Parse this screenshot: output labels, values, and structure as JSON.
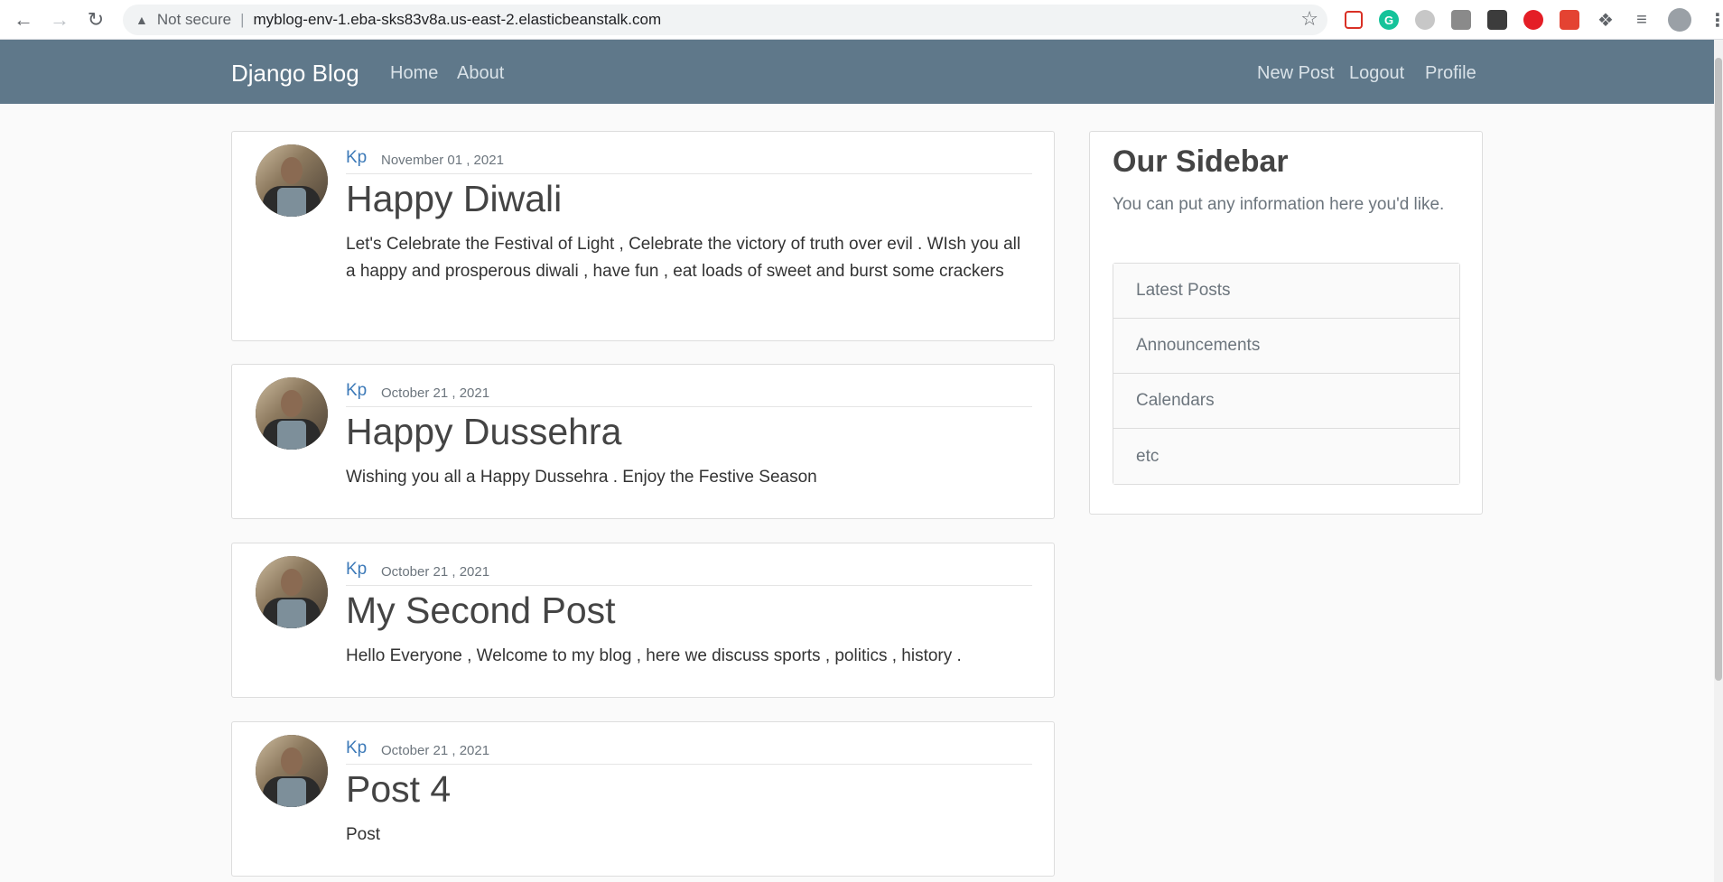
{
  "browser": {
    "security_label": "Not secure",
    "url": "myblog-env-1.eba-sks83v8a.us-east-2.elasticbeanstalk.com"
  },
  "navbar": {
    "brand": "Django Blog",
    "left_links": [
      "Home",
      "About"
    ],
    "right_links": [
      "New Post",
      "Logout",
      "Profile"
    ]
  },
  "posts": [
    {
      "author": "Kp",
      "date": "November 01 , 2021",
      "title": "Happy Diwali",
      "content": "Let's Celebrate the Festival of Light , Celebrate the victory of truth over evil . WIsh you all a happy and prosperous diwali , have fun , eat loads of sweet and burst some crackers"
    },
    {
      "author": "Kp",
      "date": "October 21 , 2021",
      "title": "Happy Dussehra",
      "content": "Wishing you all a Happy Dussehra . Enjoy the Festive Season"
    },
    {
      "author": "Kp",
      "date": "October 21 , 2021",
      "title": "My Second Post",
      "content": "Hello Everyone , Welcome to my blog , here we discuss sports , politics , history ."
    },
    {
      "author": "Kp",
      "date": "October 21 , 2021",
      "title": "Post 4",
      "content": "Post"
    }
  ],
  "sidebar": {
    "title": "Our Sidebar",
    "description": "You can put any information here you'd like.",
    "items": [
      "Latest Posts",
      "Announcements",
      "Calendars",
      "etc"
    ]
  },
  "colors": {
    "navbar_bg": "#5f788a",
    "link": "#3d7ab8",
    "page_bg": "#fafafa"
  }
}
